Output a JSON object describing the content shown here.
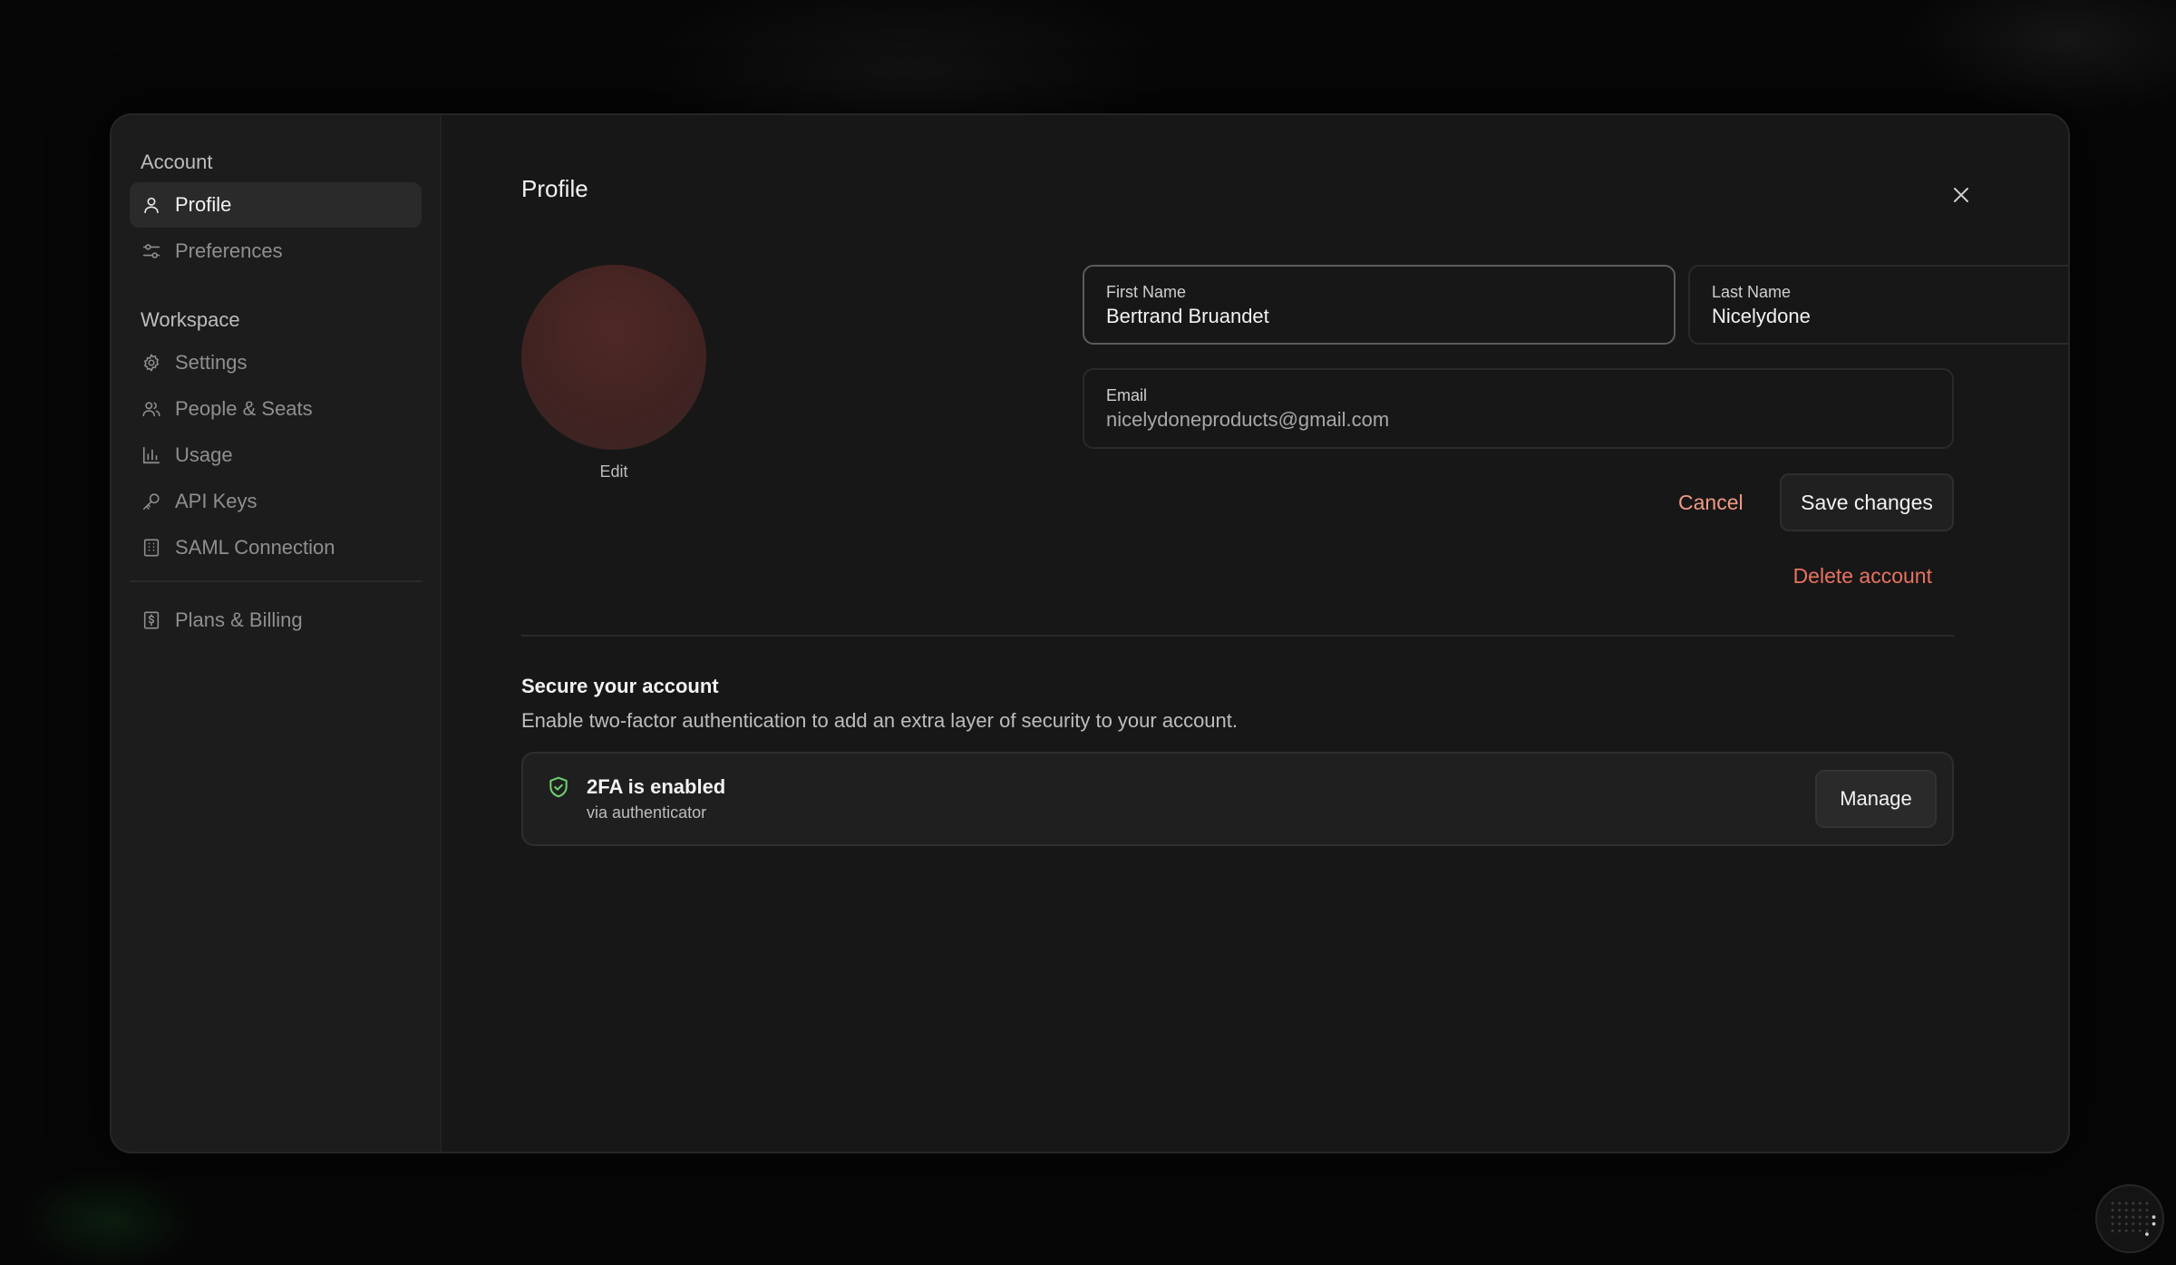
{
  "sidebar": {
    "account_title": "Account",
    "account_items": [
      {
        "label": "Profile",
        "icon": "user-icon",
        "active": true
      },
      {
        "label": "Preferences",
        "icon": "sliders-icon",
        "active": false
      }
    ],
    "workspace_title": "Workspace",
    "workspace_items": [
      {
        "label": "Settings",
        "icon": "gear-icon"
      },
      {
        "label": "People & Seats",
        "icon": "people-icon"
      },
      {
        "label": "Usage",
        "icon": "bar-chart-icon"
      },
      {
        "label": "API Keys",
        "icon": "key-icon"
      },
      {
        "label": "SAML Connection",
        "icon": "building-icon"
      }
    ],
    "billing_item": {
      "label": "Plans & Billing",
      "icon": "dollar-receipt-icon"
    }
  },
  "profile": {
    "title": "Profile",
    "avatar_edit": "Edit",
    "first_name": {
      "label": "First Name",
      "value": "Bertrand Bruandet"
    },
    "last_name": {
      "label": "Last Name",
      "value": "Nicelydone"
    },
    "email": {
      "label": "Email",
      "value": "nicelydoneproducts@gmail.com"
    },
    "cancel_label": "Cancel",
    "save_label": "Save changes",
    "delete_label": "Delete account"
  },
  "security": {
    "title": "Secure your account",
    "description": "Enable two-factor authentication to add an extra layer of security to your account.",
    "twofa_title": "2FA is enabled",
    "twofa_subtitle": "via authenticator",
    "manage_label": "Manage"
  },
  "colors": {
    "accent_danger": "#e8735f",
    "accent_cancel": "#f09a84",
    "shield_green": "#6fcf72",
    "avatar": "#4a2725"
  }
}
